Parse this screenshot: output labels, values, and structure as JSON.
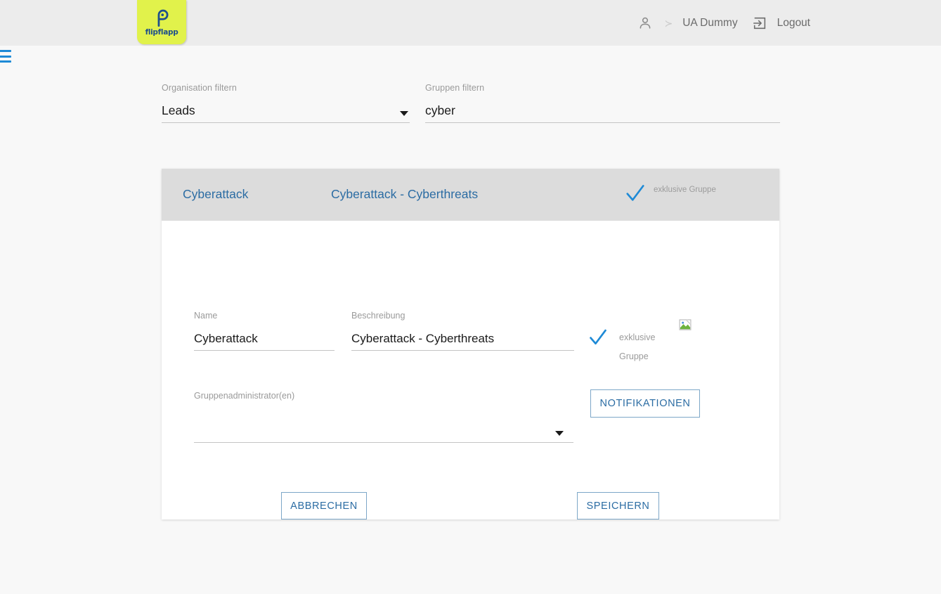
{
  "header": {
    "logo_text": "flipflapp",
    "logo_icon": "flipflapp-p-mark",
    "user_icon": "person-icon",
    "separator": "≻",
    "user_name": "UA Dummy",
    "logout_icon": "logout-icon",
    "logout_label": "Logout",
    "menu_icon": "hamburger-menu-icon"
  },
  "filters": {
    "organisation": {
      "label": "Organisation filtern",
      "value": "Leads",
      "caret_icon": "chevron-down-icon"
    },
    "gruppen": {
      "label": "Gruppen filtern",
      "value": "cyber"
    }
  },
  "card": {
    "header": {
      "name": "Cyberattack",
      "description": "Cyberattack - Cyberthreats",
      "check_icon": "checkmark-icon",
      "exclusive_label": "exklusive Gruppe"
    },
    "form": {
      "name": {
        "label": "Name",
        "value": "Cyberattack"
      },
      "description": {
        "label": "Beschreibung",
        "value": "Cyberattack - Cyberthreats"
      },
      "admins": {
        "label": "Gruppenadministrator(en)",
        "value": "",
        "caret_icon": "chevron-down-icon"
      },
      "exclusive": {
        "check_icon": "checkmark-icon",
        "line1": "exklusive",
        "line2": "Gruppe"
      },
      "image_placeholder_icon": "broken-image-icon"
    },
    "buttons": {
      "notify": "NOTIFIKATIONEN",
      "cancel": "ABBRECHEN",
      "save": "SPEICHERN"
    }
  },
  "colors": {
    "accent_blue": "#2b6ca3",
    "check_blue": "#1e8ad6",
    "logo_yellow": "#e1f24b",
    "logo_blue": "#1d4f8c",
    "header_bg": "#ececec",
    "card_header_bg": "#dcdcdc",
    "page_bg": "#f8f8f8"
  }
}
